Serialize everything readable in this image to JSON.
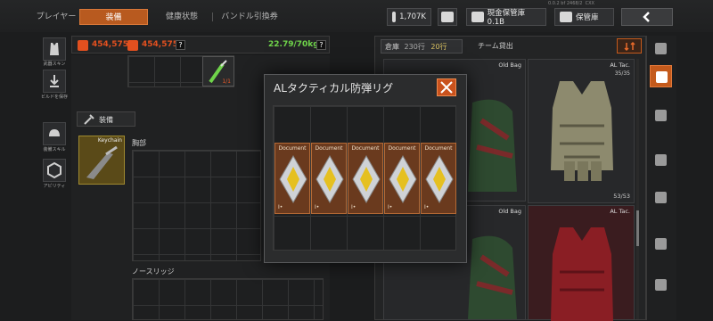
{
  "status_line": "0.0.2 bf 2468/2  CXX          ",
  "tabs": {
    "player": "プレイヤー",
    "equipment": "装備",
    "health": "健康状態",
    "bundle": "バンドル引換券"
  },
  "currency": {
    "coins": "1,707K",
    "cash_storage": "現金保管庫0.1B",
    "storage": "保管庫"
  },
  "sidebar": {
    "skin_label": "武器スキン",
    "build_label": "ビルドを保存",
    "skill_label": "装備スキル",
    "ability_label": "アビリティ"
  },
  "stats": {
    "value1": "454,575",
    "value2": "454,575",
    "weight": "22.79/70kg",
    "help": "?"
  },
  "equip_panel": {
    "slot_count": "1/1",
    "section_title": "装備",
    "keychain_label": "Keychain",
    "rig_label": "胸部",
    "backpack_label": "ノースリッジ"
  },
  "right_panel": {
    "tab_storage": "倉庫",
    "capacity_a": "230行",
    "capacity_b": "20行",
    "tab_team": "チーム貸出",
    "items": [
      {
        "label": "Old Bag",
        "count": ""
      },
      {
        "label": "AL Tac.",
        "count": "35/35"
      },
      {
        "label": "",
        "count": "53/53"
      },
      {
        "label": "Old Bag",
        "count": ""
      },
      {
        "label": "AL Tac.",
        "count": ""
      }
    ]
  },
  "modal": {
    "title": "ALタクティカル防弾リグ",
    "documents": [
      {
        "label": "Document",
        "key": "Ι•"
      },
      {
        "label": "Document",
        "key": "Ι•"
      },
      {
        "label": "Document",
        "key": "Ι•"
      },
      {
        "label": "Document",
        "key": "Ι•"
      },
      {
        "label": "Document",
        "key": "Ι•"
      }
    ]
  },
  "colors": {
    "accent": "#c45a1c",
    "weight_green": "#6fd44a",
    "document_bg": "#6a3a1e",
    "rig_red": "#8a1e24"
  }
}
